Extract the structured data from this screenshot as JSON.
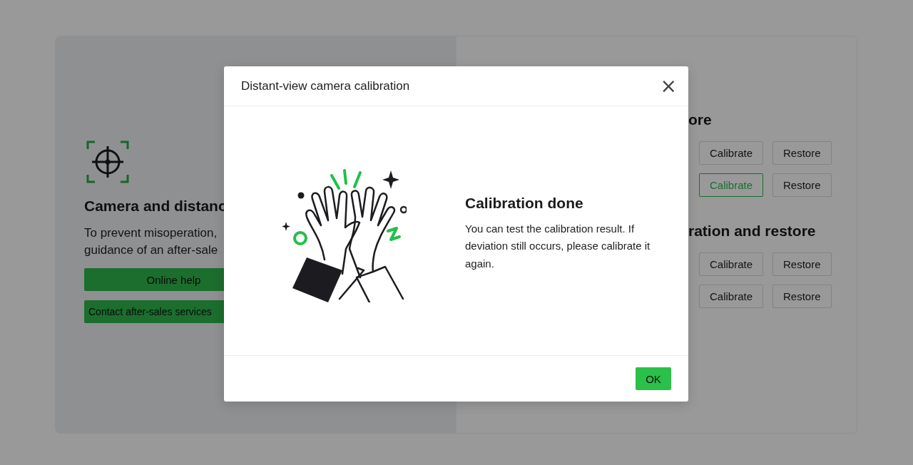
{
  "background_page": {
    "left_panel": {
      "heading": "Camera and distanc",
      "description": [
        "To prevent misoperation,",
        "guidance of an after-sale"
      ],
      "buttons": [
        "Online help",
        "Contact after-sales services"
      ]
    },
    "right_panel": {
      "sections": [
        {
          "heading": "ore",
          "rows": [
            {
              "calibrate": "Calibrate",
              "restore": "Restore",
              "selected": false
            },
            {
              "calibrate": "Calibrate",
              "restore": "Restore",
              "selected": true
            }
          ]
        },
        {
          "heading": "ration and restore",
          "rows": [
            {
              "calibrate": "Calibrate",
              "restore": "Restore",
              "selected": false
            },
            {
              "calibrate": "Calibrate",
              "restore": "Restore",
              "selected": false
            }
          ]
        }
      ]
    }
  },
  "dialog": {
    "title": "Distant-view camera calibration",
    "close": "×",
    "heading": "Calibration done",
    "message": "You can test the calibration result. If deviation still occurs, please calibrate it again.",
    "ok_button": "OK"
  }
}
